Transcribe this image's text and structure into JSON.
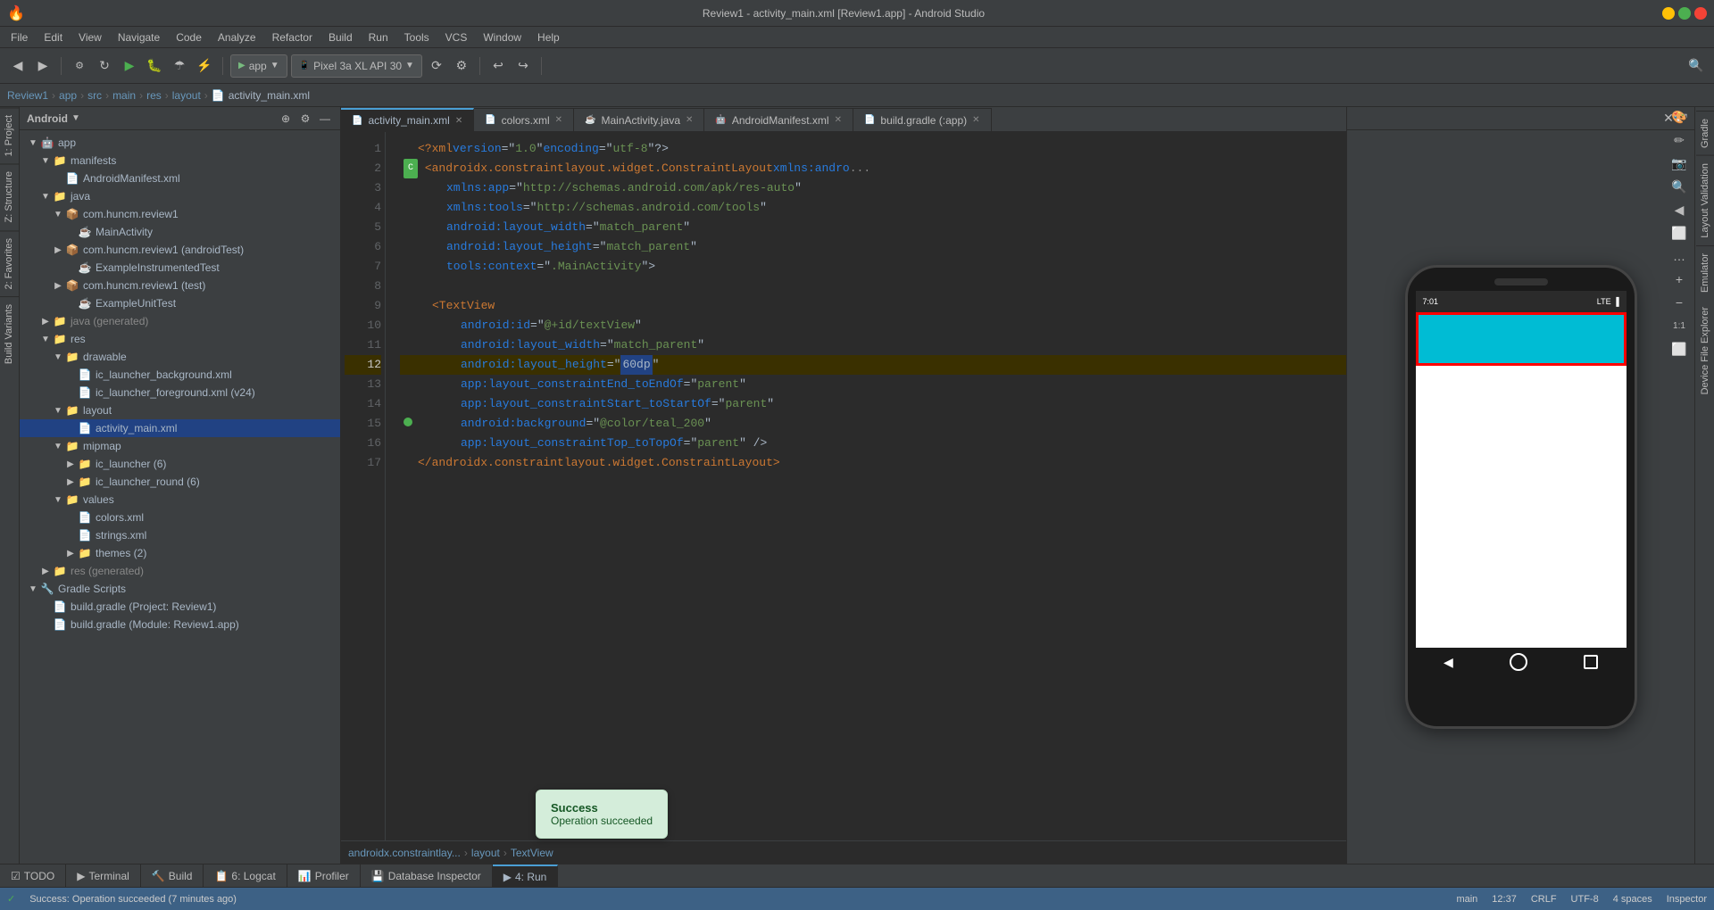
{
  "window": {
    "title": "Review1 - activity_main.xml [Review1.app] - Android Studio"
  },
  "menubar": {
    "items": [
      "🔥",
      "File",
      "Edit",
      "View",
      "Navigate",
      "Code",
      "Analyze",
      "Refactor",
      "Build",
      "Run",
      "Tools",
      "VCS",
      "Window",
      "Help"
    ]
  },
  "toolbar": {
    "app_dropdown": "app",
    "device_dropdown": "Pixel 3a XL API 30"
  },
  "breadcrumb": {
    "items": [
      "Review1",
      "app",
      "src",
      "main",
      "res",
      "layout",
      "activity_main.xml"
    ]
  },
  "project": {
    "title": "Android",
    "tree": [
      {
        "id": "app",
        "label": "app",
        "type": "folder",
        "level": 0,
        "expanded": true,
        "icon": "android"
      },
      {
        "id": "manifests",
        "label": "manifests",
        "type": "folder",
        "level": 1,
        "expanded": true,
        "icon": "folder"
      },
      {
        "id": "androidmanifest",
        "label": "AndroidManifest.xml",
        "type": "xml",
        "level": 2,
        "icon": "xml"
      },
      {
        "id": "java",
        "label": "java",
        "type": "folder",
        "level": 1,
        "expanded": true,
        "icon": "folder"
      },
      {
        "id": "huncm_review1",
        "label": "com.huncm.review1",
        "type": "package",
        "level": 2,
        "icon": "folder"
      },
      {
        "id": "mainactivity",
        "label": "MainActivity",
        "type": "java",
        "level": 3,
        "icon": "java"
      },
      {
        "id": "huncm_review1_test",
        "label": "com.huncm.review1 (androidTest)",
        "type": "package",
        "level": 2,
        "icon": "folder"
      },
      {
        "id": "exampleinstrumented",
        "label": "ExampleInstrumentedTest",
        "type": "java",
        "level": 3,
        "icon": "java"
      },
      {
        "id": "huncm_review1_unittest",
        "label": "com.huncm.review1 (test)",
        "type": "package",
        "level": 2,
        "icon": "folder"
      },
      {
        "id": "exampleunit",
        "label": "ExampleUnitTest",
        "type": "java",
        "level": 3,
        "icon": "java"
      },
      {
        "id": "java_generated",
        "label": "java (generated)",
        "type": "folder",
        "level": 1,
        "icon": "folder"
      },
      {
        "id": "res",
        "label": "res",
        "type": "folder",
        "level": 1,
        "expanded": true,
        "icon": "folder"
      },
      {
        "id": "drawable",
        "label": "drawable",
        "type": "folder",
        "level": 2,
        "expanded": true,
        "icon": "folder"
      },
      {
        "id": "ic_launcher_background",
        "label": "ic_launcher_background.xml",
        "type": "xml",
        "level": 3,
        "icon": "xml"
      },
      {
        "id": "ic_launcher_foreground",
        "label": "ic_launcher_foreground.xml (v24)",
        "type": "xml",
        "level": 3,
        "icon": "xml"
      },
      {
        "id": "layout",
        "label": "layout",
        "type": "folder",
        "level": 2,
        "expanded": true,
        "icon": "folder"
      },
      {
        "id": "activity_main_xml",
        "label": "activity_main.xml",
        "type": "xml",
        "level": 3,
        "icon": "xml",
        "selected": true
      },
      {
        "id": "mipmap",
        "label": "mipmap",
        "type": "folder",
        "level": 2,
        "expanded": true,
        "icon": "folder"
      },
      {
        "id": "ic_launcher",
        "label": "ic_launcher (6)",
        "type": "folder",
        "level": 3,
        "icon": "folder"
      },
      {
        "id": "ic_launcher_round",
        "label": "ic_launcher_round (6)",
        "type": "folder",
        "level": 3,
        "icon": "folder"
      },
      {
        "id": "values",
        "label": "values",
        "type": "folder",
        "level": 2,
        "expanded": true,
        "icon": "folder"
      },
      {
        "id": "colors_xml",
        "label": "colors.xml",
        "type": "xml",
        "level": 3,
        "icon": "xml"
      },
      {
        "id": "strings_xml",
        "label": "strings.xml",
        "type": "xml",
        "level": 3,
        "icon": "xml"
      },
      {
        "id": "themes",
        "label": "themes (2)",
        "type": "folder",
        "level": 3,
        "icon": "folder"
      },
      {
        "id": "res_generated",
        "label": "res (generated)",
        "type": "folder",
        "level": 1,
        "icon": "folder"
      },
      {
        "id": "gradle_scripts",
        "label": "Gradle Scripts",
        "type": "folder",
        "level": 0,
        "expanded": true,
        "icon": "gradle"
      },
      {
        "id": "build_gradle_project",
        "label": "build.gradle (Project: Review1)",
        "type": "gradle",
        "level": 1,
        "icon": "gradle"
      },
      {
        "id": "build_gradle_app",
        "label": "build.gradle (Module: Review1.app)",
        "type": "gradle",
        "level": 1,
        "icon": "gradle"
      }
    ]
  },
  "editor": {
    "tabs": [
      {
        "id": "activity_main",
        "label": "activity_main.xml",
        "active": true,
        "modified": false,
        "icon": "xml"
      },
      {
        "id": "colors",
        "label": "colors.xml",
        "active": false,
        "modified": false,
        "icon": "xml"
      },
      {
        "id": "mainactivity_java",
        "label": "MainActivity.java",
        "active": false,
        "modified": false,
        "icon": "java"
      },
      {
        "id": "androidmanifest_tab",
        "label": "AndroidManifest.xml",
        "active": false,
        "modified": false,
        "icon": "xml"
      },
      {
        "id": "build_gradle",
        "label": "build.gradle (:app)",
        "active": false,
        "modified": false,
        "icon": "gradle"
      }
    ],
    "code_lines": [
      {
        "num": "1",
        "content": "<?xml version=\"1.0\" encoding=\"utf-8\"?>",
        "indent": 0,
        "marker": ""
      },
      {
        "num": "2",
        "content": "<androidx.constraintlayout.widget.ConstraintLayout xmlns:andro...",
        "indent": 0,
        "marker": "C",
        "has_indicator": true
      },
      {
        "num": "3",
        "content": "xmlns:app=\"http://schemas.android.com/apk/res-auto\"",
        "indent": 2,
        "marker": ""
      },
      {
        "num": "4",
        "content": "xmlns:tools=\"http://schemas.android.com/tools\"",
        "indent": 2,
        "marker": ""
      },
      {
        "num": "5",
        "content": "android:layout_width=\"match_parent\"",
        "indent": 2,
        "marker": ""
      },
      {
        "num": "6",
        "content": "android:layout_height=\"match_parent\"",
        "indent": 2,
        "marker": ""
      },
      {
        "num": "7",
        "content": "tools:context=\".MainActivity\">",
        "indent": 2,
        "marker": ""
      },
      {
        "num": "8",
        "content": "",
        "indent": 0,
        "marker": ""
      },
      {
        "num": "9",
        "content": "<TextView",
        "indent": 1,
        "marker": ""
      },
      {
        "num": "10",
        "content": "android:id=\"@+id/textView\"",
        "indent": 3,
        "marker": ""
      },
      {
        "num": "11",
        "content": "android:layout_width=\"match_parent\"",
        "indent": 3,
        "marker": ""
      },
      {
        "num": "12",
        "content": "android:layout_height=\"60dp\"",
        "indent": 3,
        "marker": "",
        "highlighted": true
      },
      {
        "num": "13",
        "content": "app:layout_constraintEnd_toEndOf=\"parent\"",
        "indent": 3,
        "marker": ""
      },
      {
        "num": "14",
        "content": "app:layout_constraintStart_toStartOf=\"parent\"",
        "indent": 3,
        "marker": ""
      },
      {
        "num": "15",
        "content": "android:background=\"@color/teal_200\"",
        "indent": 3,
        "marker": "green"
      },
      {
        "num": "16",
        "content": "app:layout_constraintTop_toTopOf=\"parent\" />",
        "indent": 3,
        "marker": ""
      },
      {
        "num": "17",
        "content": "</androidx.constraintlayout.widget.ConstraintLayout>",
        "indent": 0,
        "marker": ""
      }
    ]
  },
  "device_preview": {
    "time": "7:01",
    "signal": "LTE",
    "teal_bar_color": "#00BCD4"
  },
  "bottom_toolbar": {
    "tabs": [
      {
        "id": "todo",
        "label": "TODO",
        "icon": "☑"
      },
      {
        "id": "terminal",
        "label": "Terminal",
        "icon": "▶"
      },
      {
        "id": "build",
        "label": "Build",
        "icon": "🔨"
      },
      {
        "id": "logcat",
        "label": "6: Logcat",
        "icon": "📋"
      },
      {
        "id": "profiler",
        "label": "Profiler",
        "icon": "📊"
      },
      {
        "id": "database",
        "label": "Database Inspector",
        "icon": "💾"
      },
      {
        "id": "run",
        "label": "4: Run",
        "icon": "▶",
        "active": true
      }
    ]
  },
  "status_bar": {
    "message": "Success: Operation succeeded (7 minutes ago)",
    "position": "12:37",
    "crlf": "CRLF",
    "encoding": "UTF-8",
    "spaces": "4 spaces"
  },
  "bottom_breadcrumb": {
    "items": [
      "androidx.constraintlayout...",
      "layout",
      "TextView"
    ]
  },
  "toast": {
    "title": "Success",
    "message": "Operation succeeded"
  },
  "right_panel": {
    "tools": [
      "🎨",
      "✏️",
      "📷",
      "🔍",
      "◀",
      "⬜",
      "…",
      "+",
      "-",
      "1:1",
      "⬜"
    ]
  },
  "gradle_panel_label": "Gradle",
  "emulator_label": "Emulator",
  "device_file_label": "Device File Explorer",
  "layout_validation_label": "Layout Validation"
}
